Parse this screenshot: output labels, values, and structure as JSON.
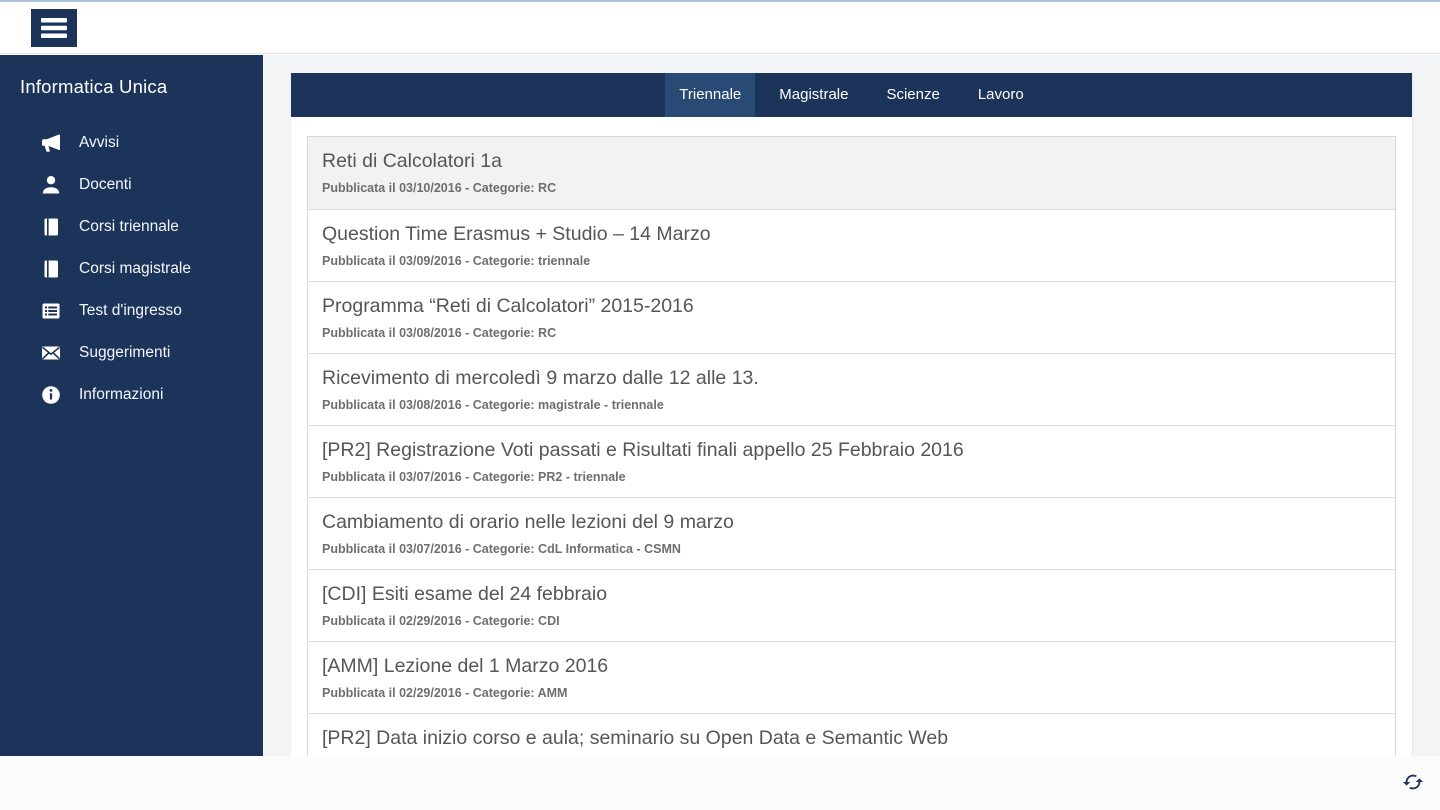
{
  "colors": {
    "navy": "#1c3459",
    "tab_active": "#2a4a76",
    "topline": "#a9c2d9",
    "page_bg": "#f3f4f5",
    "row_highlight": "#f2f2f2",
    "title_text": "#565656",
    "meta_text": "#6e6e6e"
  },
  "header": {
    "menu_icon": "hamburger"
  },
  "sidebar": {
    "title": "Informatica Unica",
    "items": [
      {
        "label": "Avvisi",
        "icon": "megaphone"
      },
      {
        "label": "Docenti",
        "icon": "user"
      },
      {
        "label": "Corsi triennale",
        "icon": "book"
      },
      {
        "label": "Corsi magistrale",
        "icon": "book"
      },
      {
        "label": "Test d'ingresso",
        "icon": "list"
      },
      {
        "label": "Suggerimenti",
        "icon": "envelope"
      },
      {
        "label": "Informazioni",
        "icon": "info"
      }
    ]
  },
  "tabs": [
    {
      "label": "Triennale",
      "active": true
    },
    {
      "label": "Magistrale",
      "active": false
    },
    {
      "label": "Scienze",
      "active": false
    },
    {
      "label": "Lavoro",
      "active": false
    }
  ],
  "announcements": [
    {
      "title": "Reti di Calcolatori 1a",
      "meta": "Pubblicata il 03/10/2016 - Categorie: RC",
      "highlighted": true
    },
    {
      "title": "Question Time Erasmus + Studio – 14 Marzo",
      "meta": "Pubblicata il 03/09/2016 - Categorie: triennale"
    },
    {
      "title": "Programma “Reti di Calcolatori” 2015-2016",
      "meta": "Pubblicata il 03/08/2016 - Categorie: RC"
    },
    {
      "title": "Ricevimento di mercoledì 9 marzo dalle 12 alle 13.",
      "meta": "Pubblicata il 03/08/2016 - Categorie: magistrale - triennale"
    },
    {
      "title": "[PR2] Registrazione Voti passati e Risultati finali appello 25 Febbraio 2016",
      "meta": "Pubblicata il 03/07/2016 - Categorie: PR2 - triennale"
    },
    {
      "title": "Cambiamento di orario nelle lezioni del 9 marzo",
      "meta": "Pubblicata il 03/07/2016 - Categorie: CdL Informatica - CSMN"
    },
    {
      "title": "[CDI] Esiti esame del 24 febbraio",
      "meta": "Pubblicata il 02/29/2016 - Categorie: CDI"
    },
    {
      "title": "[AMM] Lezione del 1 Marzo 2016",
      "meta": "Pubblicata il 02/29/2016 - Categorie: AMM"
    },
    {
      "title": "[PR2] Data inizio corso e aula; seminario su Open Data e Semantic Web",
      "meta": ""
    }
  ],
  "bottombar": {
    "refresh_icon": "refresh"
  }
}
